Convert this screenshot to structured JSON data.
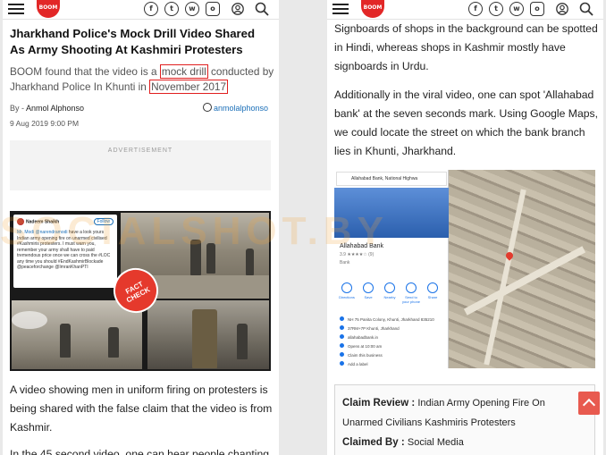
{
  "left": {
    "logo": "BOOM",
    "title": "Jharkhand Police's Mock Drill Video Shared As Army Shooting At Kashmiri Protesters",
    "summary": {
      "part1": "BOOM found that the video is a ",
      "highlight1": "mock drill",
      "part2": " conducted by Jharkhand Police In Khunti in ",
      "highlight2": "November 2017"
    },
    "byline_prefix": "By - ",
    "author": "Anmol Alphonso",
    "twitter_handle": "anmolalphonso",
    "date": "9 Aug 2019 9:00 PM",
    "ad_label": "ADVERTISEMENT",
    "image": {
      "tweet_user": "Nadeem Shaikh",
      "tweet_follow": "Follow",
      "tweet_text_mention": "Mr. Modi @narendramodi",
      "tweet_text": " have a look yours Indian army opening fire on unarmed civilised #Kashmiris protesters. I must warn you, remember your army shall have to paid tremendous price once we can cross the #LOC any time you should #EndKashmirBlockade @peaceforchange @ImranKhanPTI",
      "stamp_line1": "FACT",
      "stamp_line2": "CHECK"
    },
    "paragraph1": "A video showing men in uniform firing on protesters is being shared with the false claim that the video is from Kashmir.",
    "paragraph2": "In the 45 second video, one can hear people chanting"
  },
  "right": {
    "logo": "BOOM",
    "paragraph1": "Signboards of shops in the background can be spotted in Hindi, whereas shops in Kashmir mostly have signboards in Urdu.",
    "paragraph2": "Additionally in the viral video, one can spot 'Allahabad bank' at the seven seconds mark. Using Google Maps, we could locate the street on which the bank branch lies in Khunti, Jharkhand.",
    "map": {
      "search_text": "Allahabad Bank, National Highwa",
      "place_name": "Allahabad Bank",
      "place_rating": "3.9 ★★★★☆ (9)",
      "place_type": "Bank",
      "actions": [
        "Directions",
        "Save",
        "Nearby",
        "Send to your phone",
        "Share"
      ],
      "rows": [
        "NH 75 Panita Colony, Khunti, Jharkhand 835210",
        "37RM+7P Khunti, Jharkhand",
        "allahabadbank.in",
        "Opens at 10:00 am",
        "Claim this business",
        "Add a label"
      ]
    },
    "claim_review_label": "Claim Review : ",
    "claim_review_text": "Indian Army Opening Fire On Unarmed Civilians Kashmiris Protesters",
    "claimed_by_label": "Claimed By : ",
    "claimed_by_text": "Social Media"
  },
  "watermark": "SOCIALSHOT.BY",
  "colors": {
    "brand": "#e22727",
    "highlight_box": "#e01e1e",
    "link": "#1b6fb8",
    "scroll_top": "#e85a4f"
  },
  "icons": [
    "menu-icon",
    "facebook-icon",
    "twitter-icon",
    "whatsapp-icon",
    "instagram-icon",
    "user-icon",
    "search-icon"
  ]
}
